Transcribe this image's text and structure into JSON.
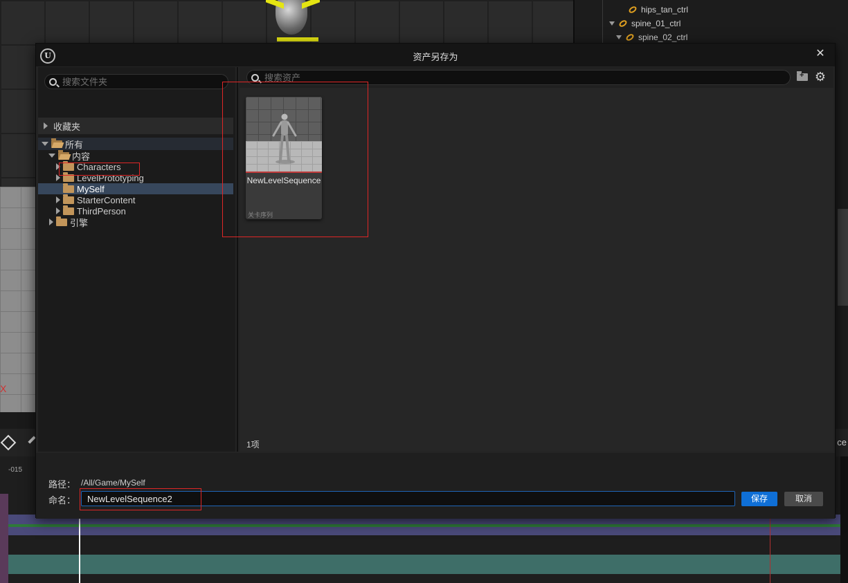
{
  "background": {
    "outliner_items": [
      {
        "label": "hips_tan_ctrl"
      },
      {
        "label": "spine_01_ctrl"
      },
      {
        "label": "spine_02_ctrl"
      }
    ],
    "axis_label": "X",
    "timeline_label": "-015",
    "right_toolbar_text": "ce"
  },
  "dialog": {
    "title": "资产另存为",
    "logo_text": "U",
    "close_symbol": "✕",
    "folder_search_placeholder": "搜索文件夹",
    "favorites_label": "收藏夹",
    "tree": [
      {
        "label": "所有"
      },
      {
        "label": "内容"
      },
      {
        "label": "Characters"
      },
      {
        "label": "LevelPrototyping"
      },
      {
        "label": "MySelf"
      },
      {
        "label": "StarterContent"
      },
      {
        "label": "ThirdPerson"
      },
      {
        "label": "引擎"
      }
    ],
    "asset_search_placeholder": "搜索资产",
    "settings_symbol": "⚙",
    "asset": {
      "name": "NewLevelSequence",
      "type": "关卡序列"
    },
    "item_count": "1项",
    "path_label": "路径：",
    "path_value": "/All/Game/MySelf",
    "name_label": "命名：",
    "name_value": "NewLevelSequence2",
    "save_label": "保存",
    "cancel_label": "取消"
  },
  "colors": {
    "accent_blue": "#0f6fd6",
    "annotation_red": "#e02626",
    "folder": "#c2955a",
    "selection": "#37475c"
  }
}
